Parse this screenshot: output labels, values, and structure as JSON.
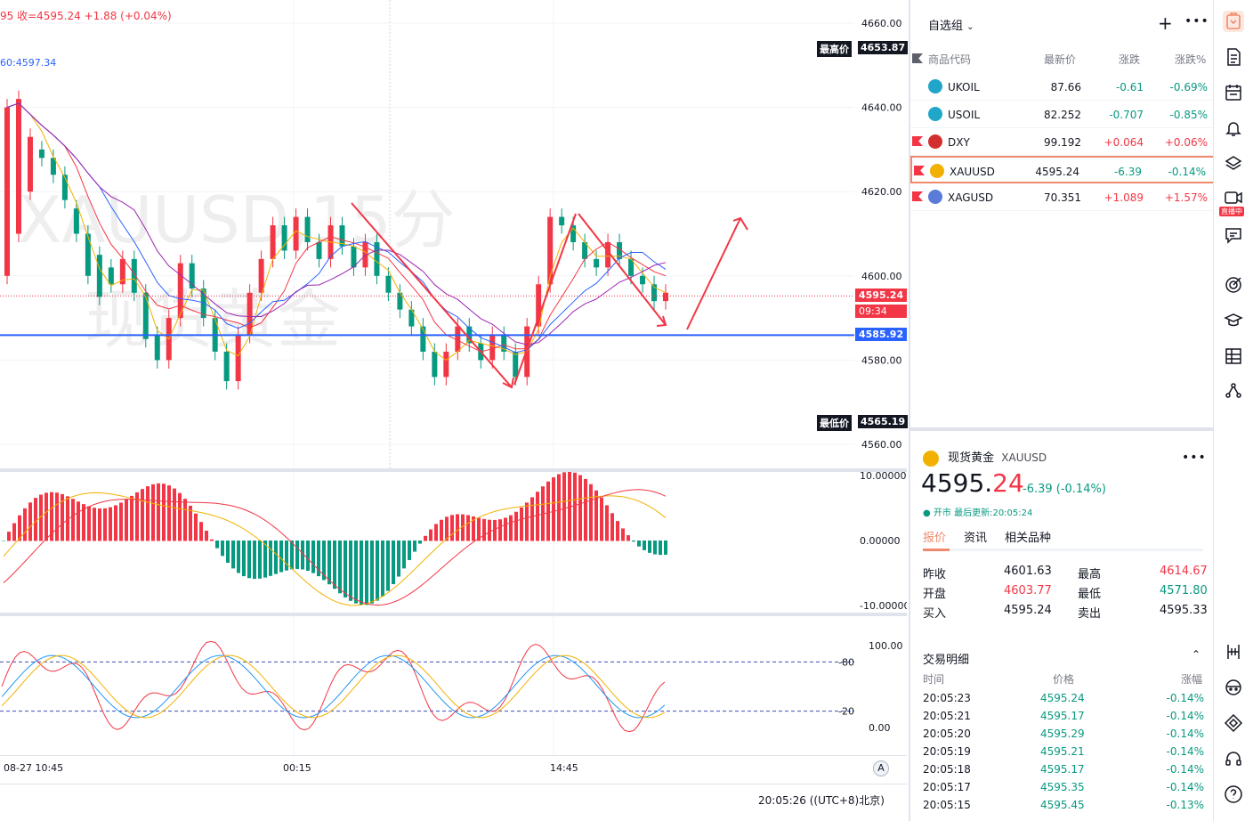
{
  "chart": {
    "symbol_watermark": "XAUUSD,15分",
    "name_watermark": "现货黄金",
    "legend_top": "95  收=4595.24  +1.88  (+0.04%)",
    "legend_ma": "60:4597.34",
    "high_label": "最高价",
    "high_value": "4653.87",
    "low_label": "最低价",
    "low_value": "4565.19",
    "current_price": "4595.24",
    "countdown": "09:34",
    "hline_value": "4585.92",
    "price_ticks": [
      "4660.00",
      "4640.00",
      "4620.00",
      "4600.00",
      "4580.00",
      "4560.00"
    ],
    "macd_ticks": [
      "10.00000",
      "0.00000",
      "-10.00000"
    ],
    "stoch_ticks": [
      "100.00",
      "0.00"
    ],
    "stoch_levels": [
      "80",
      "20"
    ],
    "time_labels": [
      "08-27 10:45",
      "00:15",
      "14:45"
    ],
    "timezone": "20:05:26 ((UTC+8)北京)",
    "auto_label": "A",
    "colors": {
      "up": "#f23645",
      "down": "#089981",
      "hline": "#2962ff",
      "arrow": "#f23645"
    }
  },
  "watchlist": {
    "title": "自选组",
    "headers": [
      "商品代码",
      "最新价",
      "涨跌",
      "涨跌%"
    ],
    "rows": [
      {
        "symbol": "UKOIL",
        "last": "87.66",
        "chg": "-0.61",
        "chgp": "-0.69%",
        "dir": "down",
        "flag": false,
        "icon": "oil-icon"
      },
      {
        "symbol": "USOIL",
        "last": "82.252",
        "chg": "-0.707",
        "chgp": "-0.85%",
        "dir": "down",
        "flag": false,
        "icon": "oil-icon"
      },
      {
        "symbol": "DXY",
        "last": "99.192",
        "chg": "+0.064",
        "chgp": "+0.06%",
        "dir": "up",
        "flag": true,
        "icon": "us-flag-icon"
      },
      {
        "symbol": "XAUUSD",
        "last": "4595.24",
        "chg": "-6.39",
        "chgp": "-0.14%",
        "dir": "down",
        "flag": true,
        "icon": "gold-icon"
      },
      {
        "symbol": "XAGUSD",
        "last": "70.351",
        "chg": "+1.089",
        "chgp": "+1.57%",
        "dir": "up",
        "flag": true,
        "icon": "silver-icon"
      }
    ]
  },
  "detail": {
    "name": "现货黄金",
    "symbol": "XAUUSD",
    "price_int": "4595.",
    "price_dec": "24",
    "change": "-6.39 (-0.14%)",
    "status": "● 开市  最后更新:20:05:24",
    "tabs": [
      "报价",
      "资讯",
      "相关品种"
    ],
    "quotes": [
      {
        "label": "昨收",
        "value": "4601.63",
        "label2": "最高",
        "value2": "4614.67"
      },
      {
        "label": "开盘",
        "value": "4603.77",
        "label2": "最低",
        "value2": "4571.80"
      },
      {
        "label": "买入",
        "value": "4595.24",
        "label2": "卖出",
        "value2": "4595.33"
      }
    ],
    "trades_title": "交易明细",
    "trade_headers": [
      "时间",
      "价格",
      "涨幅"
    ],
    "trades": [
      {
        "time": "20:05:23",
        "price": "4595.24",
        "pct": "-0.14%"
      },
      {
        "time": "20:05:21",
        "price": "4595.17",
        "pct": "-0.14%"
      },
      {
        "time": "20:05:20",
        "price": "4595.29",
        "pct": "-0.14%"
      },
      {
        "time": "20:05:19",
        "price": "4595.21",
        "pct": "-0.14%"
      },
      {
        "time": "20:05:18",
        "price": "4595.17",
        "pct": "-0.14%"
      },
      {
        "time": "20:05:17",
        "price": "4595.35",
        "pct": "-0.14%"
      },
      {
        "time": "20:05:15",
        "price": "4595.45",
        "pct": "-0.13%"
      }
    ]
  },
  "toolbar": {
    "live_badge": "直播中",
    "icons": [
      "watchlist-icon",
      "notes-icon",
      "calendar-icon",
      "alert-icon",
      "layers-icon",
      "live-video-icon",
      "chat-icon",
      "target-icon",
      "academy-icon",
      "grid-icon",
      "network-icon",
      "ruler-icon",
      "face-icon",
      "diamond-icon",
      "headset-icon",
      "help-icon"
    ]
  }
}
